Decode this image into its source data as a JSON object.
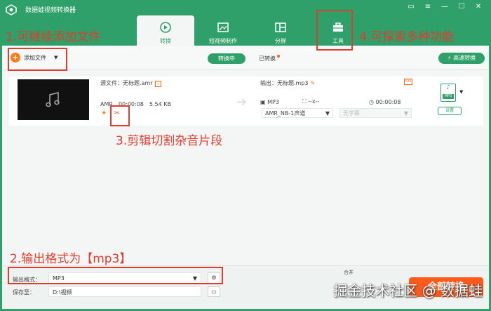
{
  "app": {
    "title": "数据蛙视频转换器"
  },
  "window_controls": [
    "chat-icon",
    "menu-icon",
    "minimize-icon",
    "maximize-icon",
    "close-icon"
  ],
  "tabs": [
    {
      "label": "转换",
      "icon": "convert-icon",
      "active": true
    },
    {
      "label": "短视频制作",
      "icon": "short-video-icon",
      "active": false
    },
    {
      "label": "分屏",
      "icon": "split-screen-icon",
      "active": false
    },
    {
      "label": "工具",
      "icon": "toolbox-icon",
      "active": false
    }
  ],
  "toolbar": {
    "add_file_label": "添加文件",
    "converting_label": "转换中",
    "converted_label": "已转换",
    "high_speed_label": "高速转换"
  },
  "file": {
    "source_name": "源文件：无标题.amr",
    "source_format": "AMR",
    "source_duration": "00:00:08",
    "source_size": "5.54 KB",
    "output_name": "输出：无标题.mp3",
    "output_format": "MP3",
    "output_resolution": "--x--",
    "output_duration": "00:00:08",
    "codec": "AMR_NB-1声道",
    "subtitle_placeholder": "无字幕",
    "format_badge": "MP3",
    "settings_label": "设置"
  },
  "bottom": {
    "format_label": "输出格式：",
    "format_value": "MP3",
    "save_label": "保存至：",
    "save_path": "D:\\视频",
    "merge_label": "合并",
    "convert_label": "全部转换"
  },
  "annotations": {
    "a1": "1.可继续添加文件",
    "a2": "2.输出格式为【mp3】",
    "a3": "3.剪辑切割杂音片段",
    "a4": "4.可探索多种功能"
  },
  "watermark": "掘金技术社区 @ 数据蛙",
  "colors": {
    "brand": "#2fa06a",
    "accent": "#ff5a1a",
    "annotation": "#e33b2e"
  }
}
